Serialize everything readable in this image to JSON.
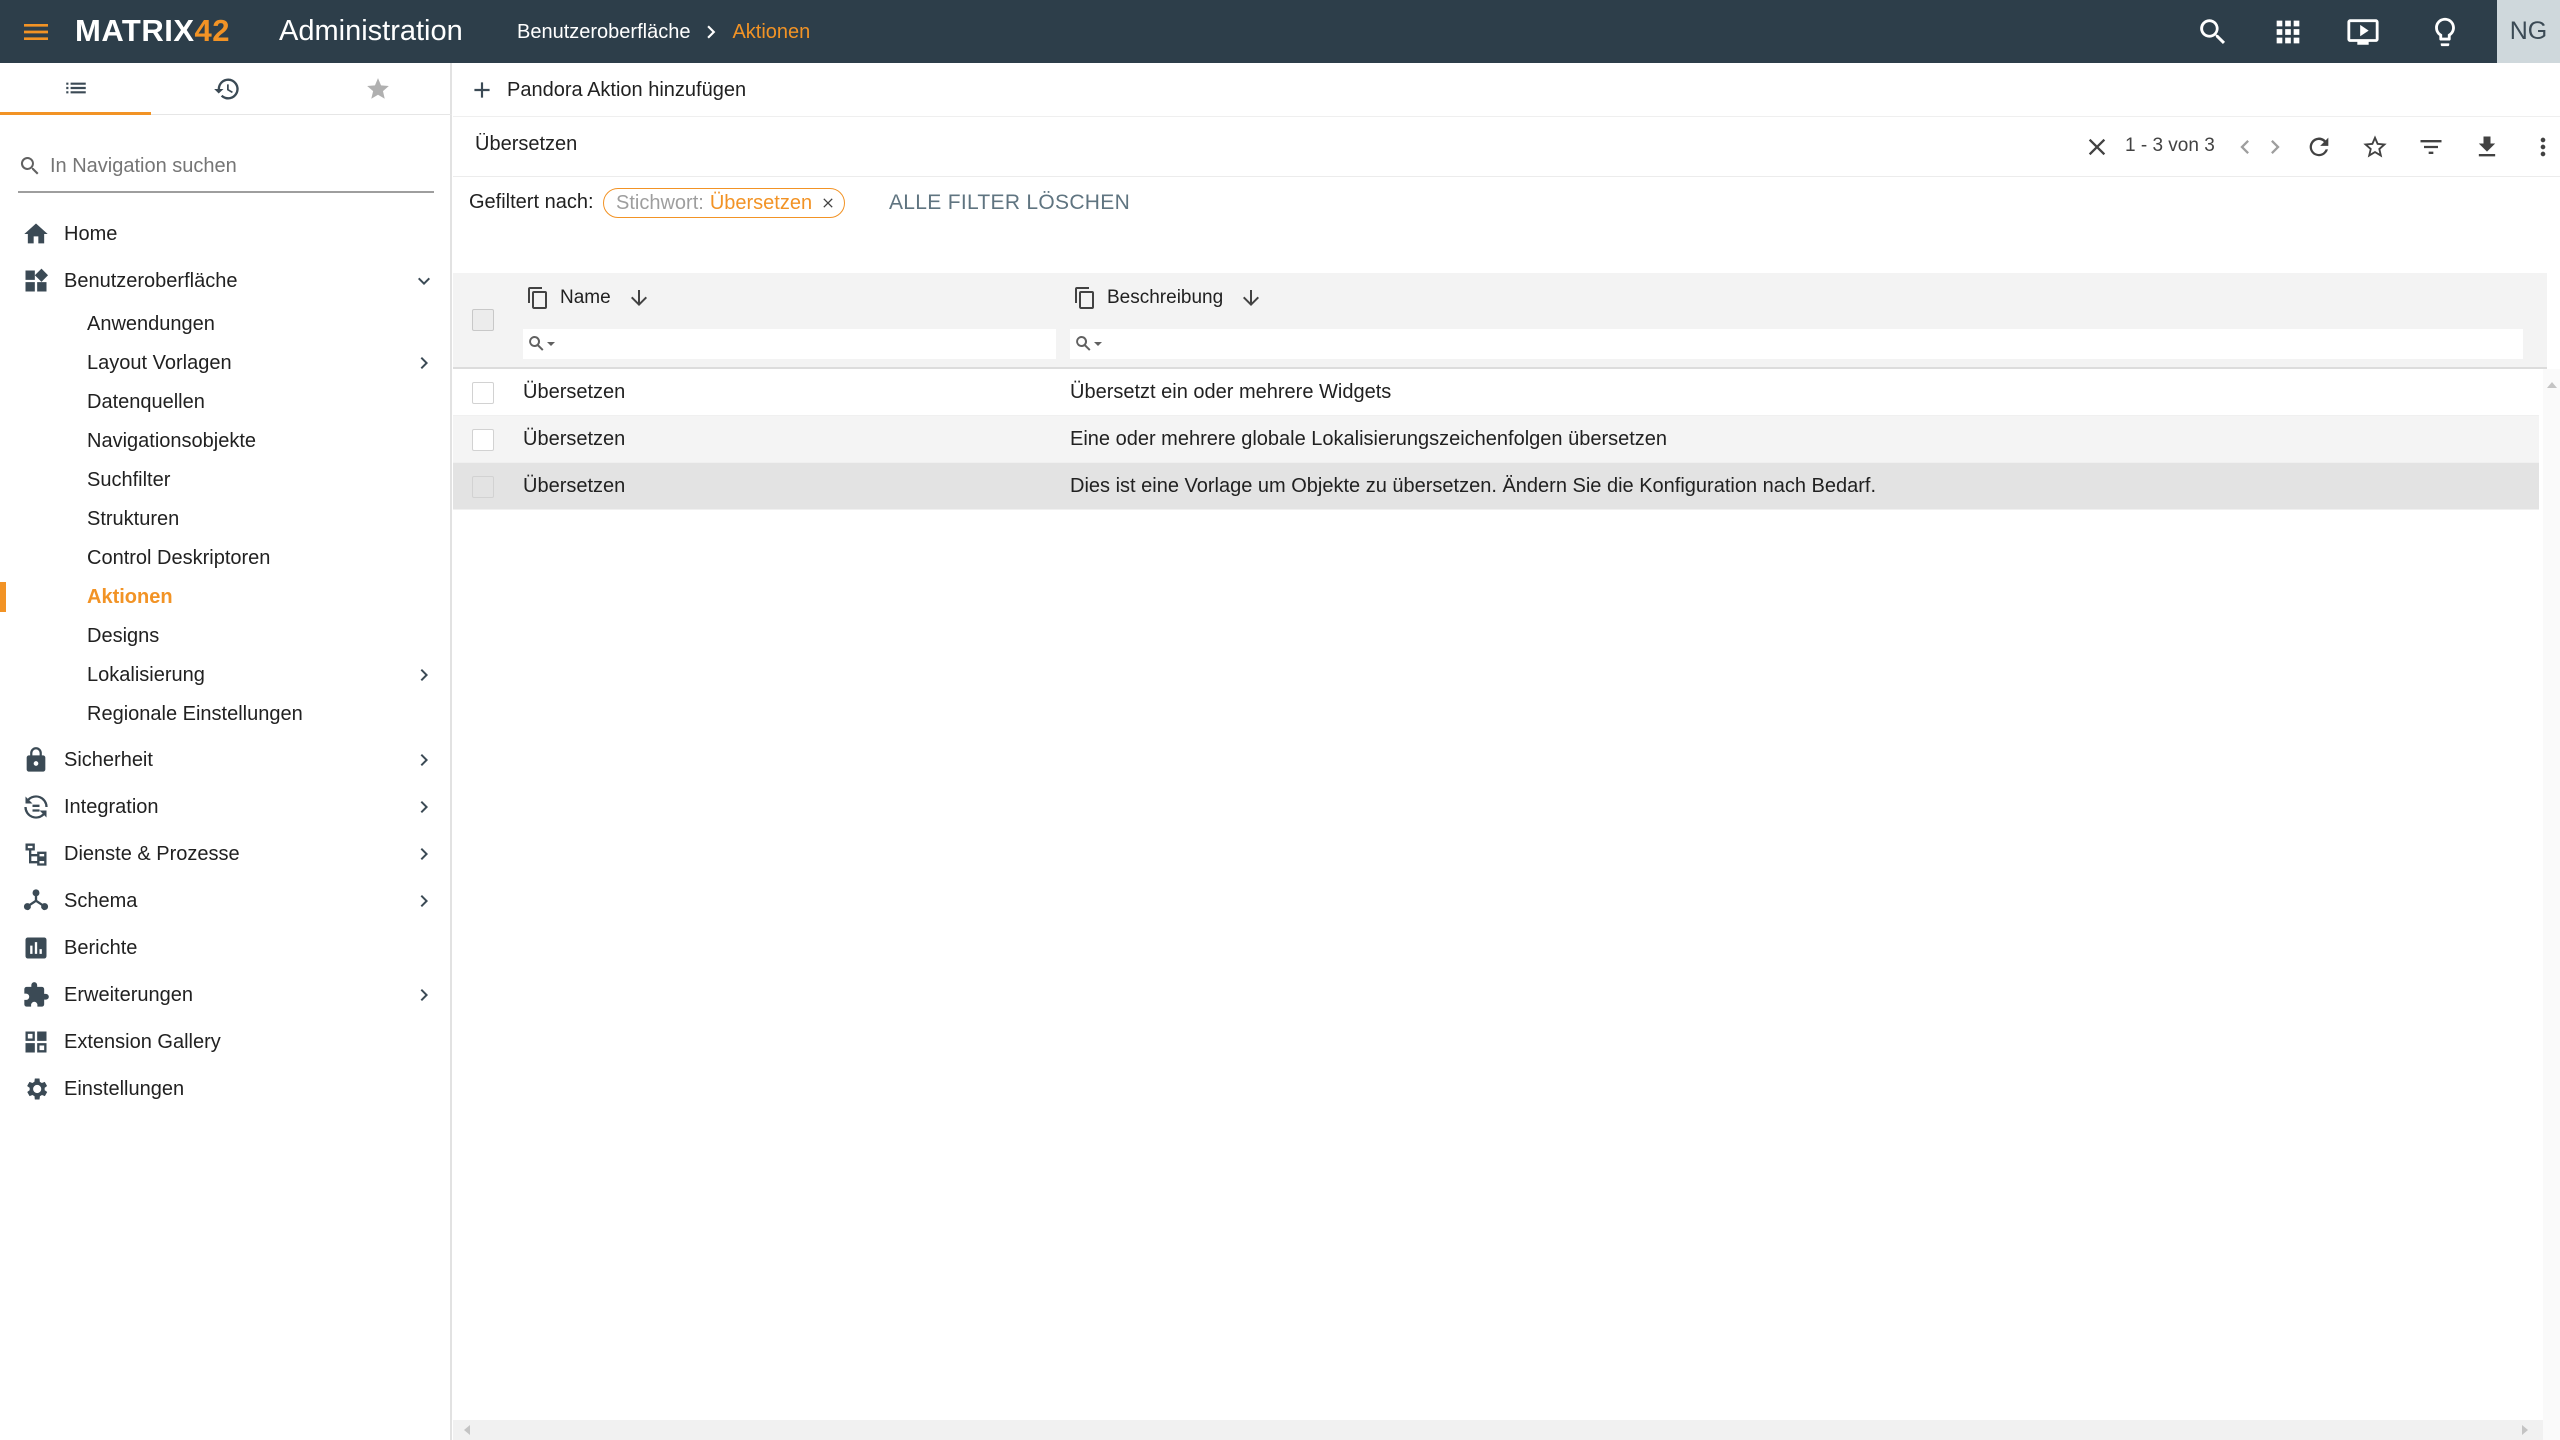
{
  "topbar": {
    "logo_main": "MATRIX",
    "logo_accent": "42",
    "app_title": "Administration",
    "breadcrumb": [
      "Benutzeroberfläche",
      "Aktionen"
    ],
    "user_initials": "NG",
    "accent_color": "#f29325",
    "bar_color": "#2d3e4a",
    "icons": [
      "search-icon",
      "apps-grid-icon",
      "play-screen-icon",
      "lightbulb-icon"
    ]
  },
  "sidebar": {
    "tabs": [
      "list-icon",
      "history-icon",
      "star-icon"
    ],
    "search_placeholder": "In Navigation suchen",
    "items": [
      {
        "label": "Home",
        "icon": "home-icon"
      },
      {
        "label": "Benutzeroberfläche",
        "icon": "dashboard-icon",
        "expanded": true,
        "children": [
          {
            "label": "Anwendungen"
          },
          {
            "label": "Layout Vorlagen",
            "has_children": true
          },
          {
            "label": "Datenquellen"
          },
          {
            "label": "Navigationsobjekte"
          },
          {
            "label": "Suchfilter"
          },
          {
            "label": "Strukturen"
          },
          {
            "label": "Control Deskriptoren"
          },
          {
            "label": "Aktionen",
            "active": true
          },
          {
            "label": "Designs"
          },
          {
            "label": "Lokalisierung",
            "has_children": true
          },
          {
            "label": "Regionale Einstellungen"
          }
        ]
      },
      {
        "label": "Sicherheit",
        "icon": "lock-icon",
        "has_children": true
      },
      {
        "label": "Integration",
        "icon": "integration-icon",
        "has_children": true
      },
      {
        "label": "Dienste & Prozesse",
        "icon": "process-icon",
        "has_children": true
      },
      {
        "label": "Schema",
        "icon": "schema-icon",
        "has_children": true
      },
      {
        "label": "Berichte",
        "icon": "report-icon"
      },
      {
        "label": "Erweiterungen",
        "icon": "puzzle-icon",
        "has_children": true
      },
      {
        "label": "Extension Gallery",
        "icon": "gallery-icon"
      },
      {
        "label": "Einstellungen",
        "icon": "gear-icon"
      }
    ]
  },
  "main": {
    "add_action_label": "Pandora Aktion hinzufügen",
    "search_value": "Übersetzen",
    "pager": "1 - 3 von 3",
    "filter_label": "Gefiltert nach:",
    "chip_key": "Stichwort:",
    "chip_value": "Übersetzen",
    "clear_filters_label": "ALLE FILTER LÖSCHEN",
    "columns": [
      "Name",
      "Beschreibung"
    ],
    "rows": [
      {
        "name": "Übersetzen",
        "description": "Übersetzt ein oder mehrere Widgets"
      },
      {
        "name": "Übersetzen",
        "description": "Eine oder mehrere globale Lokalisierungszeichenfolgen übersetzen"
      },
      {
        "name": "Übersetzen",
        "description": "Dies ist eine Vorlage um Objekte zu übersetzen. Ändern Sie die Konfiguration nach Bedarf."
      }
    ]
  }
}
